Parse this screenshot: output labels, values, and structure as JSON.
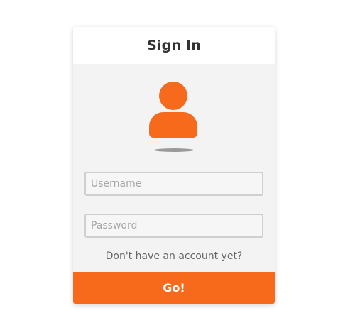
{
  "login": {
    "title": "Sign In",
    "avatar_icon": "user-avatar-icon",
    "username": {
      "placeholder": "Username",
      "value": ""
    },
    "password": {
      "placeholder": "Password",
      "value": ""
    },
    "signup_link": "Don't have an account yet?",
    "submit_label": "Go!"
  },
  "colors": {
    "accent": "#f76a1c",
    "card_background": "#f3f3f3",
    "header_background": "#ffffff",
    "title_text": "#333333"
  }
}
